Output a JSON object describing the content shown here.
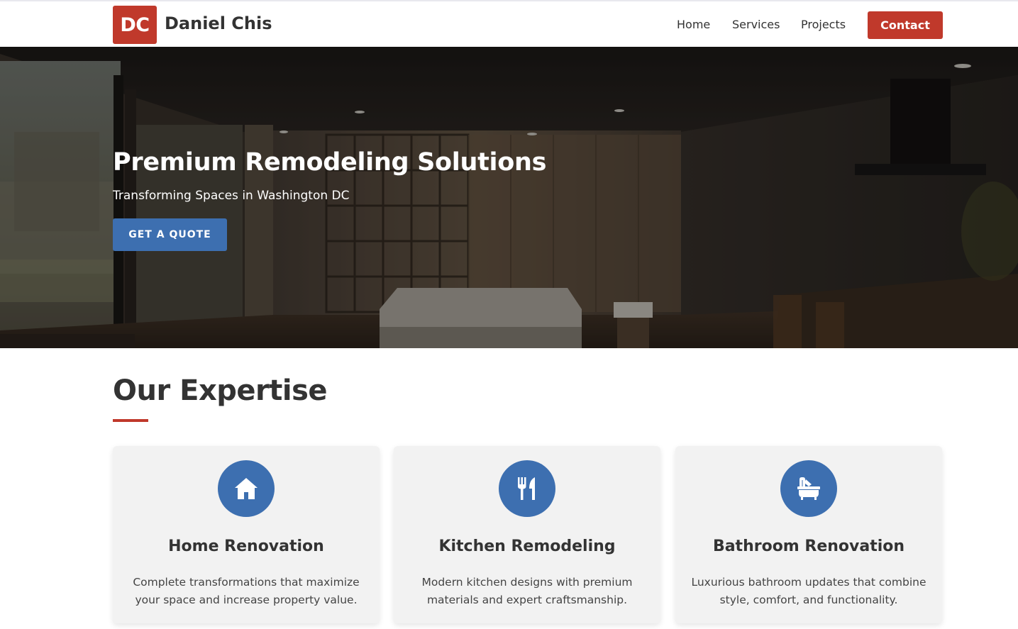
{
  "brand": {
    "logo_initials": "DC",
    "name": "Daniel Chis",
    "accent_color": "#c0392b",
    "secondary_color": "#3d6fb0"
  },
  "nav": {
    "items": [
      {
        "label": "Home"
      },
      {
        "label": "Services"
      },
      {
        "label": "Projects"
      }
    ],
    "contact_label": "Contact"
  },
  "hero": {
    "title": "Premium Remodeling Solutions",
    "subtitle": "Transforming Spaces in Washington DC",
    "cta_label": "GET A QUOTE"
  },
  "expertise": {
    "title": "Our Expertise",
    "cards": [
      {
        "icon": "home-icon",
        "title": "Home Renovation",
        "description": "Complete transformations that maximize your space and increase property value."
      },
      {
        "icon": "utensils-icon",
        "title": "Kitchen Remodeling",
        "description": "Modern kitchen designs with premium materials and expert craftsmanship."
      },
      {
        "icon": "bath-icon",
        "title": "Bathroom Renovation",
        "description": "Luxurious bathroom updates that combine style, comfort, and functionality."
      }
    ]
  }
}
